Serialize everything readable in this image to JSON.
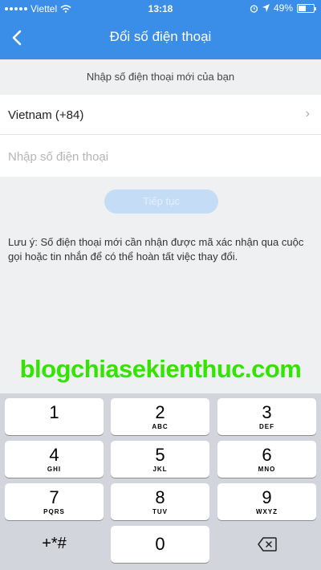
{
  "status_bar": {
    "carrier": "Viettel",
    "time": "13:18",
    "battery": "49%",
    "battery_level": 0.49
  },
  "nav": {
    "title": "Đổi số điện thoại",
    "back_icon": "chevron-left-icon"
  },
  "instruction": "Nhập số điện thoại mới của bạn",
  "country": {
    "label": "Vietnam (+84)",
    "chevron": "›"
  },
  "phone": {
    "placeholder": "Nhập số điện thoại",
    "value": ""
  },
  "continue_label": "Tiếp tục",
  "note": "Lưu ý: Số điện thoại mới cần nhận được mã xác nhận qua cuộc gọi hoặc tin nhắn để có thể hoàn tất việc thay đổi.",
  "watermark": "blogchiasekienthuc.com",
  "keypad": {
    "k1": {
      "digit": "1",
      "letters": ""
    },
    "k2": {
      "digit": "2",
      "letters": "ABC"
    },
    "k3": {
      "digit": "3",
      "letters": "DEF"
    },
    "k4": {
      "digit": "4",
      "letters": "GHI"
    },
    "k5": {
      "digit": "5",
      "letters": "JKL"
    },
    "k6": {
      "digit": "6",
      "letters": "MNO"
    },
    "k7": {
      "digit": "7",
      "letters": "PQRS"
    },
    "k8": {
      "digit": "8",
      "letters": "TUV"
    },
    "k9": {
      "digit": "9",
      "letters": "WXYZ"
    },
    "symbols": "+*#",
    "k0": {
      "digit": "0"
    },
    "backspace_icon": "backspace-icon"
  },
  "colors": {
    "header": "#3a8ee8",
    "watermark": "#32e400",
    "button_disabled": "#c4dcf6"
  }
}
